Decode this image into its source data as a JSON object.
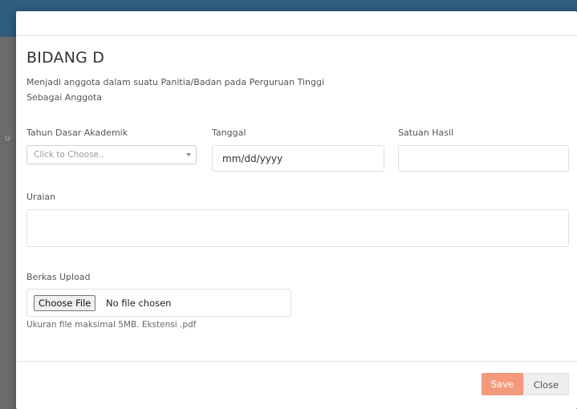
{
  "modal": {
    "title": "BIDANG D",
    "description_line1": "Menjadi anggota dalam suatu Panitia/Badan pada Perguruan Tinggi",
    "description_line2": "Sebagai Anggota"
  },
  "form": {
    "tahun_label": "Tahun Dasar Akademik",
    "tahun_placeholder": "Click to Choose..",
    "tanggal_label": "Tanggal",
    "tanggal_value": "mm/dd/yyyy",
    "satuan_label": "Satuan Hasil",
    "satuan_value": "",
    "uraian_label": "Uraian",
    "uraian_value": "",
    "berkas_label": "Berkas Upload",
    "choose_file_label": "Choose File",
    "no_file_text": "No file chosen",
    "file_hint": "Ukuran file maksimal 5MB. Ekstensi .pdf"
  },
  "footer": {
    "save_label": "Save",
    "close_label": "Close"
  },
  "background": {
    "partial_text": "u"
  },
  "colors": {
    "header_bar": "#2f5d7c",
    "save_button": "#f49a7c",
    "close_button": "#eeeeee",
    "overlay": "#6b6b6b"
  },
  "icons": {
    "select_caret": "chevron-down-icon"
  }
}
